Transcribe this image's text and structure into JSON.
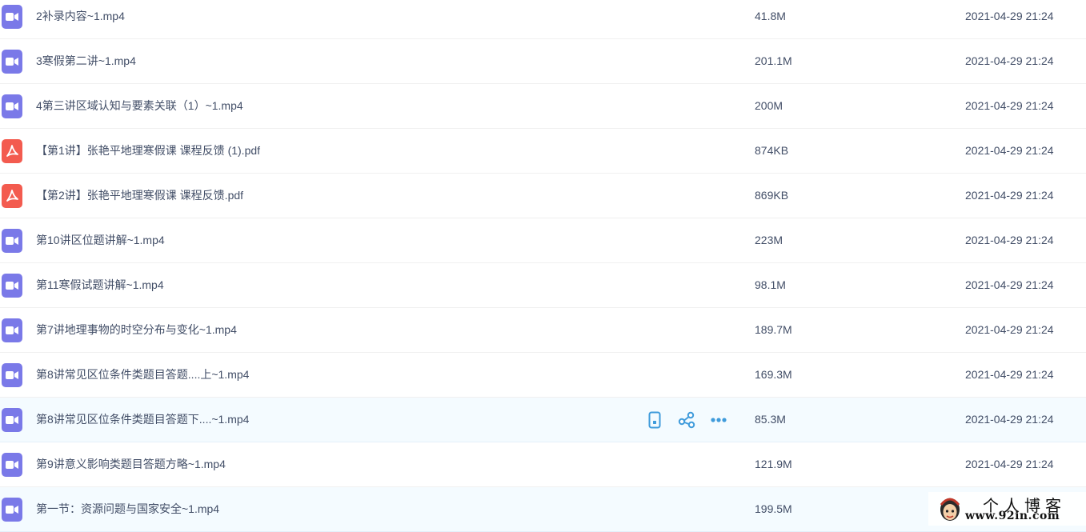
{
  "files": [
    {
      "type": "video",
      "name": "2补录内容~1.mp4",
      "size": "41.8M",
      "date": "2021-04-29 21:24"
    },
    {
      "type": "video",
      "name": "3寒假第二讲~1.mp4",
      "size": "201.1M",
      "date": "2021-04-29 21:24"
    },
    {
      "type": "video",
      "name": "4第三讲区域认知与要素关联（1）~1.mp4",
      "size": "200M",
      "date": "2021-04-29 21:24"
    },
    {
      "type": "pdf",
      "name": "【第1讲】张艳平地理寒假课 课程反馈 (1).pdf",
      "size": "874KB",
      "date": "2021-04-29 21:24"
    },
    {
      "type": "pdf",
      "name": "【第2讲】张艳平地理寒假课 课程反馈.pdf",
      "size": "869KB",
      "date": "2021-04-29 21:24"
    },
    {
      "type": "video",
      "name": "第10讲区位题讲解~1.mp4",
      "size": "223M",
      "date": "2021-04-29 21:24"
    },
    {
      "type": "video",
      "name": "第11寒假试题讲解~1.mp4",
      "size": "98.1M",
      "date": "2021-04-29 21:24"
    },
    {
      "type": "video",
      "name": "第7讲地理事物的时空分布与变化~1.mp4",
      "size": "189.7M",
      "date": "2021-04-29 21:24"
    },
    {
      "type": "video",
      "name": "第8讲常见区位条件类题目答题....上~1.mp4",
      "size": "169.3M",
      "date": "2021-04-29 21:24"
    },
    {
      "type": "video",
      "name": "第8讲常见区位条件类题目答题下....~1.mp4",
      "size": "85.3M",
      "date": "2021-04-29 21:24"
    },
    {
      "type": "video",
      "name": "第9讲意义影响类题目答题方略~1.mp4",
      "size": "121.9M",
      "date": "2021-04-29 21:24"
    },
    {
      "type": "video",
      "name": "第一节：资源问题与国家安全~1.mp4",
      "size": "199.5M",
      "date": ""
    }
  ],
  "hover_row": {
    "name": "第8讲常见区位条件类题目答题下....~1.mp4",
    "size": "85.3M",
    "date": "2021-04-29 21:24",
    "actions": [
      {
        "icon": "phone-icon"
      },
      {
        "icon": "share-icon"
      },
      {
        "icon": "more-icon"
      }
    ]
  },
  "colors": {
    "video_icon": "#7a79e8",
    "pdf_icon": "#f35b4f",
    "action_icon": "#3f9bdb",
    "hover_bg": "#f4fbff",
    "text": "#424e67"
  },
  "watermark": {
    "title": "个人博客",
    "url": "www.92in.com"
  }
}
